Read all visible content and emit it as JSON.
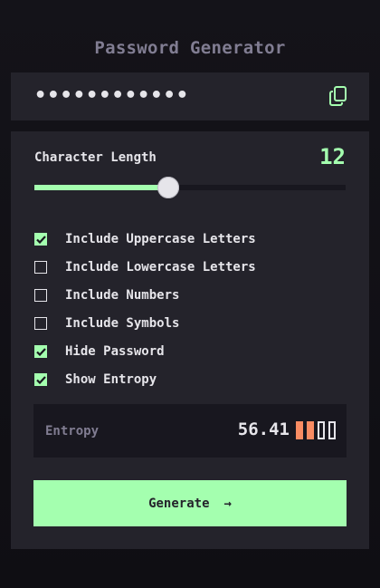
{
  "app": {
    "title": "Password Generator"
  },
  "output": {
    "password": "••••••••••••",
    "copy_icon": "copy-icon"
  },
  "length": {
    "label": "Character Length",
    "value": "12",
    "slider_fraction": 0.43
  },
  "options": [
    {
      "label": "Include Uppercase Letters",
      "checked": true
    },
    {
      "label": "Include Lowercase Letters",
      "checked": false
    },
    {
      "label": "Include Numbers",
      "checked": false
    },
    {
      "label": "Include Symbols",
      "checked": false
    },
    {
      "label": "Hide Password",
      "checked": true
    },
    {
      "label": "Show Entropy",
      "checked": true
    }
  ],
  "entropy": {
    "label": "Entropy",
    "value": "56.41",
    "bars_filled": 2,
    "bars_total": 4
  },
  "generate": {
    "label": "Generate",
    "icon": "arrow-right-icon"
  },
  "colors": {
    "accent": "#a4ffaf",
    "strength": "#f98c63",
    "panel": "#24232b",
    "muted": "#817d92"
  }
}
